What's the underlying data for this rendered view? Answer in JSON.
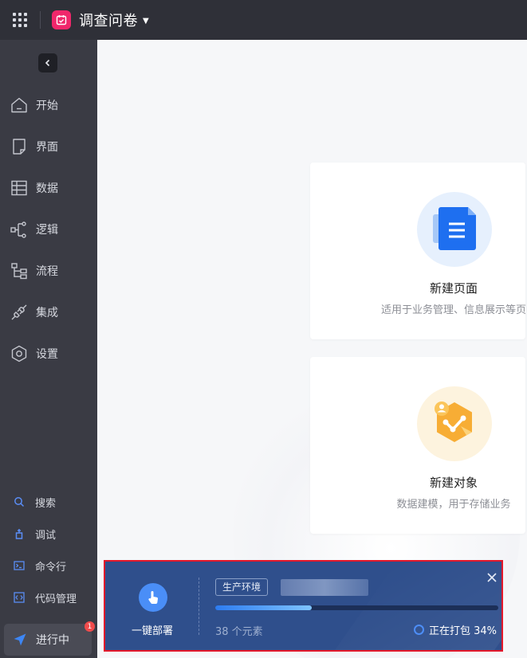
{
  "topbar": {
    "app_title": "调查问卷"
  },
  "sidebar": {
    "nav": [
      {
        "label": "开始"
      },
      {
        "label": "界面"
      },
      {
        "label": "数据"
      },
      {
        "label": "逻辑"
      },
      {
        "label": "流程"
      },
      {
        "label": "集成"
      },
      {
        "label": "设置"
      }
    ],
    "utils": [
      {
        "label": "搜索"
      },
      {
        "label": "调试"
      },
      {
        "label": "命令行"
      },
      {
        "label": "代码管理"
      }
    ],
    "status": {
      "label": "进行中",
      "badge": "1"
    }
  },
  "cards": [
    {
      "title": "新建页面",
      "desc": "适用于业务管理、信息展示等页"
    },
    {
      "title": "新建对象",
      "desc": "数据建模，用于存储业务"
    }
  ],
  "deploy": {
    "label": "一键部署",
    "env_tag": "生产环境",
    "element_count": "38 个元素",
    "status": "正在打包 34%",
    "progress": 0.34
  },
  "colors": {
    "accent": "#2d7cf0",
    "sidebar_bg": "#3a3b44",
    "topbar_bg": "#2f3038",
    "toast_border": "#e3182b",
    "app_logo": "#f0276b"
  }
}
